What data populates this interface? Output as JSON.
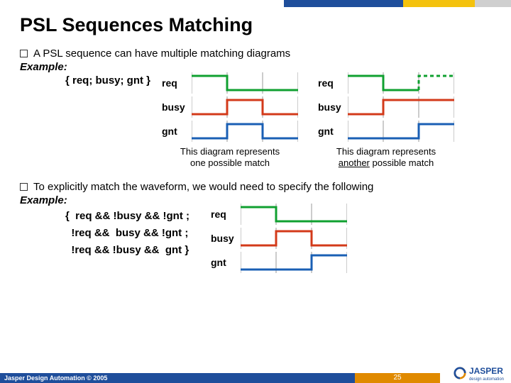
{
  "header": {
    "title": "PSL Sequences Matching"
  },
  "bullet1": "A PSL sequence can have multiple matching diagrams",
  "example_label": "Example:",
  "sequence1": "{ req; busy; gnt }",
  "signals": {
    "req": "req",
    "busy": "busy",
    "gnt": "gnt"
  },
  "caption1_a": "This diagram represents",
  "caption1_b": "one possible match",
  "caption2_a": "This diagram represents",
  "caption2_b_u": "another",
  "caption2_b_rest": " possible match",
  "bullet2": "To explicitly match the waveform, we would need to specify the following",
  "seq2": {
    "l1": "{  req && !busy && !gnt ;",
    "l2": "  !req &&  busy && !gnt ;",
    "l3": "  !req && !busy &&  gnt }"
  },
  "footer": {
    "copyright": "Jasper Design Automation © 2005",
    "page": "25",
    "brand": "JASPER",
    "brand_sub": "design automation"
  },
  "chart_data": [
    {
      "type": "timing",
      "name": "diagram1_left",
      "clock_ticks": 3,
      "signals": [
        {
          "name": "req",
          "color": "#10a030",
          "levels": [
            1,
            0,
            0
          ],
          "dashed_after": false
        },
        {
          "name": "busy",
          "color": "#d33a1a",
          "levels": [
            0,
            1,
            0
          ]
        },
        {
          "name": "gnt",
          "color": "#1a5fb4",
          "levels": [
            0,
            1,
            0
          ]
        }
      ],
      "caption": "This diagram represents one possible match"
    },
    {
      "type": "timing",
      "name": "diagram1_right",
      "clock_ticks": 3,
      "signals": [
        {
          "name": "req",
          "color": "#10a030",
          "levels": [
            1,
            0,
            1
          ],
          "dashed_after": true
        },
        {
          "name": "busy",
          "color": "#d33a1a",
          "levels": [
            0,
            1,
            1
          ]
        },
        {
          "name": "gnt",
          "color": "#1a5fb4",
          "levels": [
            0,
            0,
            1
          ]
        }
      ],
      "caption": "This diagram represents another possible match"
    },
    {
      "type": "timing",
      "name": "diagram2",
      "clock_ticks": 3,
      "signals": [
        {
          "name": "req",
          "color": "#10a030",
          "levels": [
            1,
            0,
            0
          ]
        },
        {
          "name": "busy",
          "color": "#d33a1a",
          "levels": [
            0,
            1,
            0
          ]
        },
        {
          "name": "gnt",
          "color": "#1a5fb4",
          "levels": [
            0,
            0,
            1
          ]
        }
      ],
      "caption": ""
    }
  ]
}
